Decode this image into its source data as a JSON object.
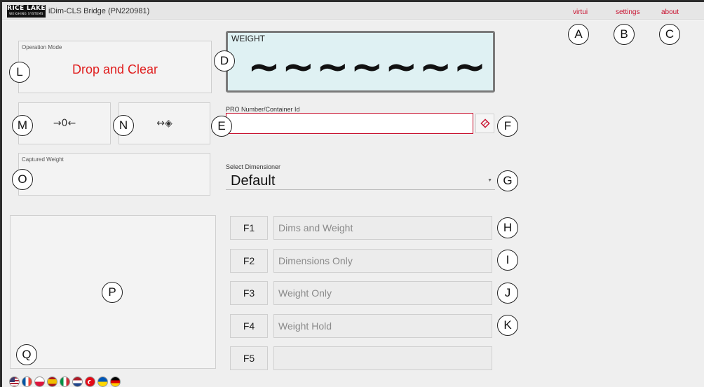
{
  "app": {
    "logo_text": "RICE LAKE",
    "logo_subtext": "WEIGHING SYSTEMS",
    "title": "iDim-CLS Bridge (PN220981)"
  },
  "nav": {
    "virtui": "virtui",
    "settings": "settings",
    "about": "about"
  },
  "operation_mode": {
    "label": "Operation Mode",
    "value": "Drop and Clear"
  },
  "zero_button": {
    "icon": "zero-icon",
    "glyph": "→0←"
  },
  "dimension_button": {
    "icon": "dimension-target-icon",
    "glyph": "↔◈"
  },
  "captured_weight": {
    "label": "Captured Weight",
    "value": ""
  },
  "weight_display": {
    "label": "WEIGHT",
    "value": "~~~~~~~"
  },
  "pro_number": {
    "label": "PRO Number/Container Id",
    "value": "",
    "placeholder": ""
  },
  "clear_field_button": {
    "icon": "eraser-icon",
    "glyph": "◇"
  },
  "dimensioner": {
    "label": "Select Dimensioner",
    "value": "Default"
  },
  "functions": [
    {
      "key": "F1",
      "label": "Dims and Weight"
    },
    {
      "key": "F2",
      "label": "Dimensions Only"
    },
    {
      "key": "F3",
      "label": "Weight Only"
    },
    {
      "key": "F4",
      "label": "Weight Hold"
    },
    {
      "key": "F5",
      "label": ""
    }
  ],
  "callouts": [
    "A",
    "B",
    "C",
    "D",
    "E",
    "F",
    "G",
    "H",
    "I",
    "J",
    "K",
    "L",
    "M",
    "N",
    "O",
    "P",
    "Q"
  ],
  "languages": [
    "us-flag-icon",
    "france-flag-icon",
    "poland-flag-icon",
    "spain-flag-icon",
    "italy-flag-icon",
    "netherlands-flag-icon",
    "turkey-flag-icon",
    "ukraine-flag-icon",
    "germany-flag-icon"
  ],
  "colors": {
    "accent_red": "#c8102e",
    "weight_bg": "#dff1f3",
    "mode_text": "#e01e1e"
  }
}
